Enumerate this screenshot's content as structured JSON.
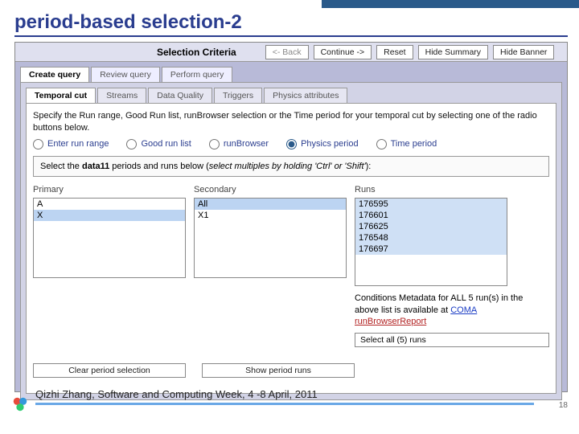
{
  "slide": {
    "title": "period-based selection-2",
    "footer": "Qizhi Zhang, Software and Computing Week, 4 -8 April, 2011",
    "page": "18"
  },
  "topbar": {
    "title": "Selection Criteria",
    "back": "<- Back",
    "continue": "Continue ->",
    "reset": "Reset",
    "hide_summary": "Hide Summary",
    "hide_banner": "Hide Banner"
  },
  "tabs1": [
    {
      "label": "Create query",
      "active": true
    },
    {
      "label": "Review query",
      "active": false
    },
    {
      "label": "Perform query",
      "active": false
    }
  ],
  "tabs2": [
    {
      "label": "Temporal cut",
      "active": true
    },
    {
      "label": "Streams",
      "active": false
    },
    {
      "label": "Data Quality",
      "active": false
    },
    {
      "label": "Triggers",
      "active": false
    },
    {
      "label": "Physics attributes",
      "active": false
    }
  ],
  "intro": "Specify the Run range, Good Run list, runBrowser selection or the Time period for your temporal cut by selecting one of the radio buttons below.",
  "radios": [
    {
      "id": "run-range",
      "label": "Enter run range",
      "checked": false
    },
    {
      "id": "good-run-list",
      "label": "Good run list",
      "checked": false
    },
    {
      "id": "run-browser",
      "label": "runBrowser",
      "checked": false
    },
    {
      "id": "physics-period",
      "label": "Physics period",
      "checked": true
    },
    {
      "id": "time-period",
      "label": "Time period",
      "checked": false
    }
  ],
  "select_instruction_pre": "Select the ",
  "select_instruction_bold": "data11",
  "select_instruction_mid": " periods and runs below (",
  "select_instruction_italic": "select multiples by holding 'Ctrl' or 'Shift'",
  "select_instruction_end": "):",
  "primary": {
    "label": "Primary",
    "items": [
      "A",
      "X"
    ]
  },
  "secondary": {
    "label": "Secondary",
    "items": [
      "All",
      "X1"
    ]
  },
  "runs": {
    "label": "Runs",
    "items": [
      "176595",
      "176601",
      "176625",
      "176548",
      "176697"
    ]
  },
  "conditions": {
    "pre": "Conditions Metadata for ALL 5 run(s) in the above list is available at ",
    "link": "COMA",
    "red": "runBrowserReport"
  },
  "buttons": {
    "clear": "Clear period selection",
    "show": "Show period runs",
    "select_all": "Select all (5) runs"
  }
}
